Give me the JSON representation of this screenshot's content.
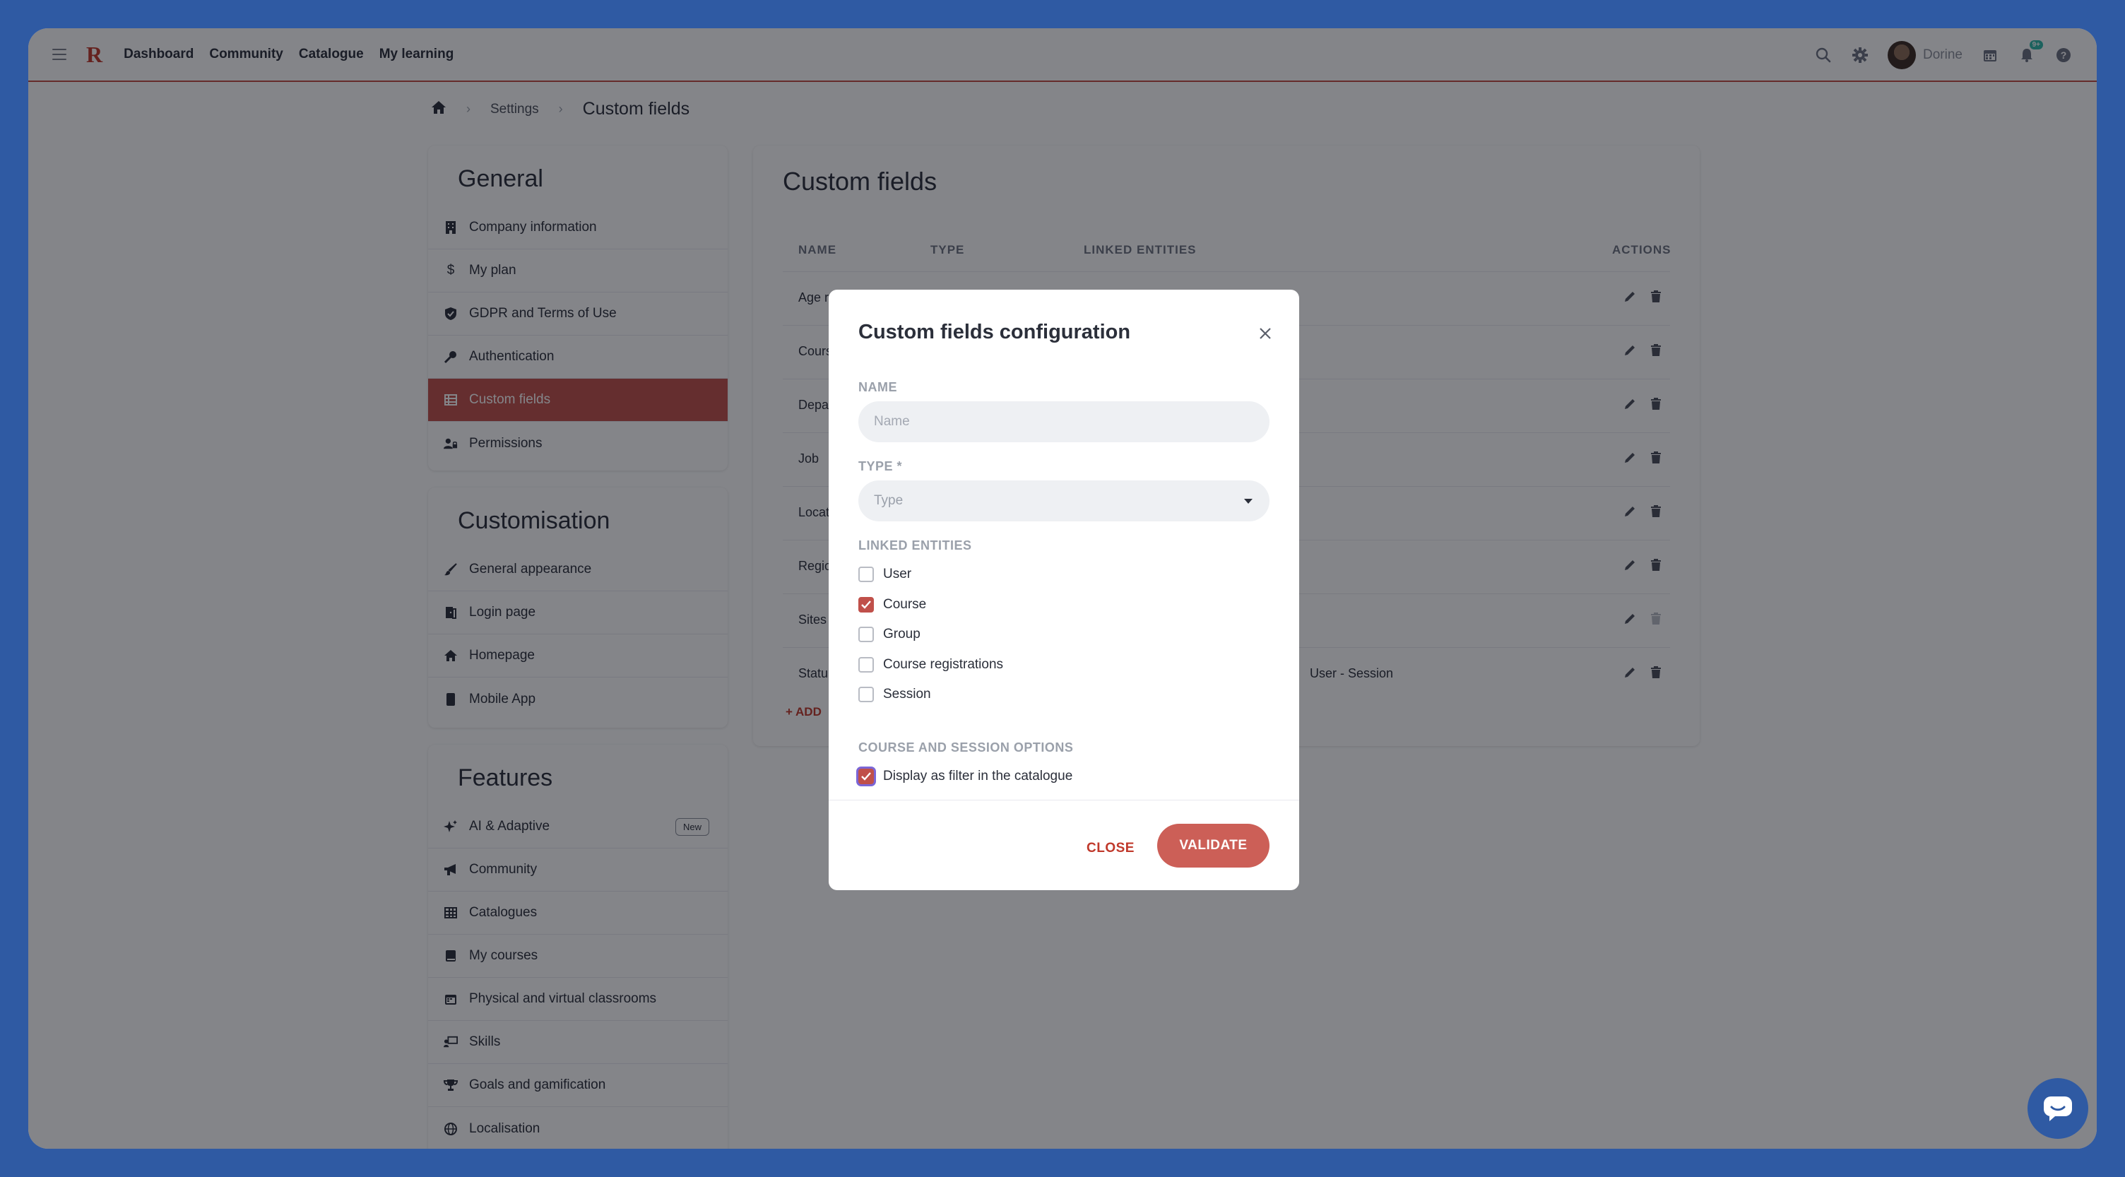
{
  "nav": {
    "links": [
      "Dashboard",
      "Community",
      "Catalogue",
      "My learning"
    ],
    "user_name": "Dorine",
    "notification_badge": "9+"
  },
  "breadcrumb": {
    "settings": "Settings",
    "current": "Custom fields"
  },
  "sidebar": {
    "general": {
      "title": "General",
      "items": [
        "Company information",
        "My plan",
        "GDPR and Terms of Use",
        "Authentication",
        "Custom fields",
        "Permissions"
      ]
    },
    "customisation": {
      "title": "Customisation",
      "items": [
        "General appearance",
        "Login page",
        "Homepage",
        "Mobile App"
      ]
    },
    "features": {
      "title": "Features",
      "items": [
        "AI & Adaptive",
        "Community",
        "Catalogues",
        "My courses",
        "Physical and virtual classrooms",
        "Skills",
        "Goals and gamification",
        "Localisation"
      ],
      "new_tag": "New"
    }
  },
  "main": {
    "title": "Custom fields",
    "columns": [
      "NAME",
      "TYPE",
      "LINKED ENTITIES",
      "ACTIONS"
    ],
    "rows": [
      {
        "name": "Age r",
        "links": ""
      },
      {
        "name": "Cours",
        "links": ""
      },
      {
        "name": "Depa",
        "links": ""
      },
      {
        "name": "Job",
        "links": ""
      },
      {
        "name": "Locat",
        "links": ""
      },
      {
        "name": "Regio",
        "links": ""
      },
      {
        "name": "Sites",
        "links": ""
      },
      {
        "name": "Statu",
        "links": "User - Session"
      }
    ],
    "add_label": "ADD"
  },
  "modal": {
    "title": "Custom fields configuration",
    "name_label": "NAME",
    "name_placeholder": "Name",
    "type_label": "TYPE *",
    "type_placeholder": "Type",
    "linked_label": "LINKED ENTITIES",
    "entities": [
      {
        "label": "User",
        "checked": false
      },
      {
        "label": "Course",
        "checked": true
      },
      {
        "label": "Group",
        "checked": false
      },
      {
        "label": "Course registrations",
        "checked": false
      },
      {
        "label": "Session",
        "checked": false
      }
    ],
    "options_label": "COURSE AND SESSION OPTIONS",
    "display_filter": {
      "label": "Display as filter in the catalogue",
      "checked": true
    },
    "close_label": "CLOSE",
    "validate_label": "VALIDATE"
  },
  "colors": {
    "accent": "#c0504a",
    "background": "#2f5aa3"
  }
}
